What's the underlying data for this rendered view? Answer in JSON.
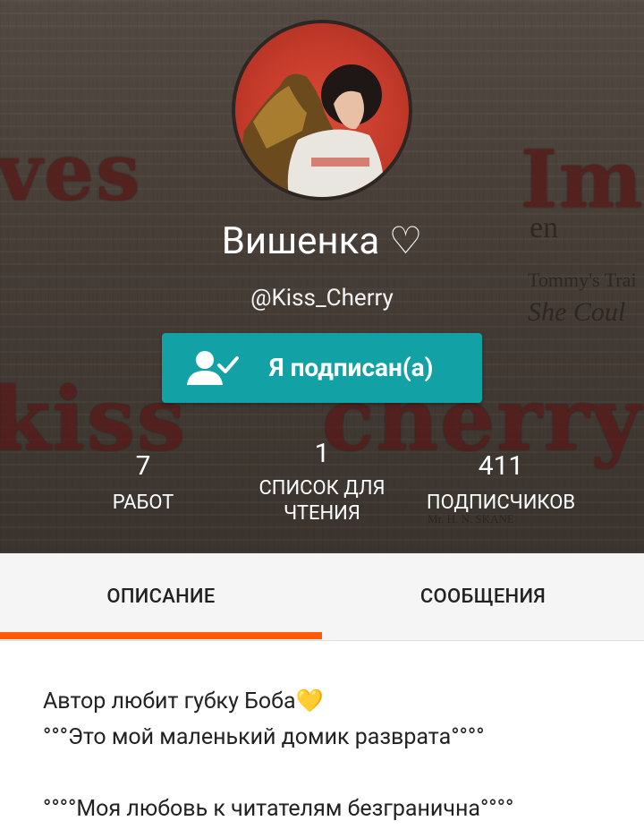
{
  "profile": {
    "display_name": "Вишенка ♡",
    "username": "@Kiss_Cherry",
    "follow_button_label": "Я подписан(а)"
  },
  "stats": [
    {
      "value": "7",
      "label": "РАБОТ"
    },
    {
      "value": "1",
      "label": "СПИСОК ДЛЯ ЧТЕНИЯ"
    },
    {
      "value": "411",
      "label": "ПОДПИСЧИКОВ"
    }
  ],
  "header_background": {
    "words": [
      "ves",
      "Im",
      "kiss",
      "cherry"
    ],
    "newspaper_fragments": [
      "Tommy's Trai",
      "She Coul",
      "en",
      "Mr. H. N. SKANE"
    ]
  },
  "tabs": [
    {
      "label": "ОПИСАНИЕ",
      "active": true
    },
    {
      "label": "СООБЩЕНИЯ",
      "active": false
    }
  ],
  "description": {
    "line1": "Автор любит губку Боба💛",
    "line2": "°°°Это мой маленький домик разврата°°°°",
    "line3": "°°°°Моя любовь к читателям безгранична°°°°"
  },
  "colors": {
    "follow_button": "#12a2a6",
    "tab_indicator": "#ff5a0a",
    "tabs_bg": "#f5f5f5"
  },
  "icons": {
    "follow_button_icon": "user-check-icon"
  }
}
